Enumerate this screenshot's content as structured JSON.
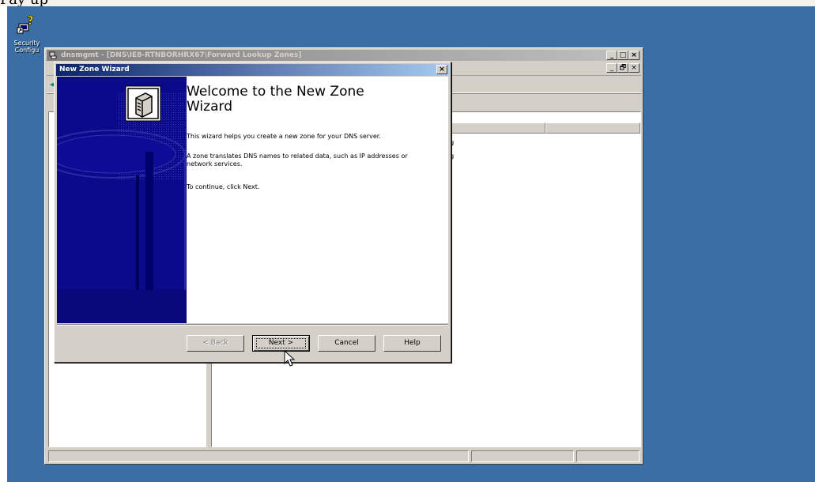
{
  "page_top_text": "Pay up",
  "desktop": {
    "icon_label_line1": "Security",
    "icon_label_line2": "Configu"
  },
  "mmc": {
    "title": "dnsmgmt - [DNS\\IE8-RTNBORHRX67\\Forward Lookup Zones]",
    "title_buttons": [
      "_",
      "□",
      "×"
    ],
    "menubar_buttons": [
      "_",
      "🗗",
      "×"
    ],
    "list_header": [
      "s",
      "",
      ""
    ],
    "list_rows": [
      "ng",
      "ng"
    ],
    "tree_partial": [
      "⅄",
      "E"
    ]
  },
  "wizard": {
    "title": "New Zone Wizard",
    "close_label": "×",
    "heading": "Welcome to the New Zone Wizard",
    "para1": "This wizard helps you create a new zone for your DNS server.",
    "para2": "A zone translates DNS names to related data, such as IP addresses or network services.",
    "para3": "To continue, click Next.",
    "buttons": {
      "back": "< Back",
      "next": "Next >",
      "cancel": "Cancel",
      "help": "Help"
    }
  },
  "colors": {
    "desktop": "#3a6ea5",
    "title_active": "#0a246a",
    "title_inactive": "#808080",
    "banner": "#0a0a8a"
  }
}
